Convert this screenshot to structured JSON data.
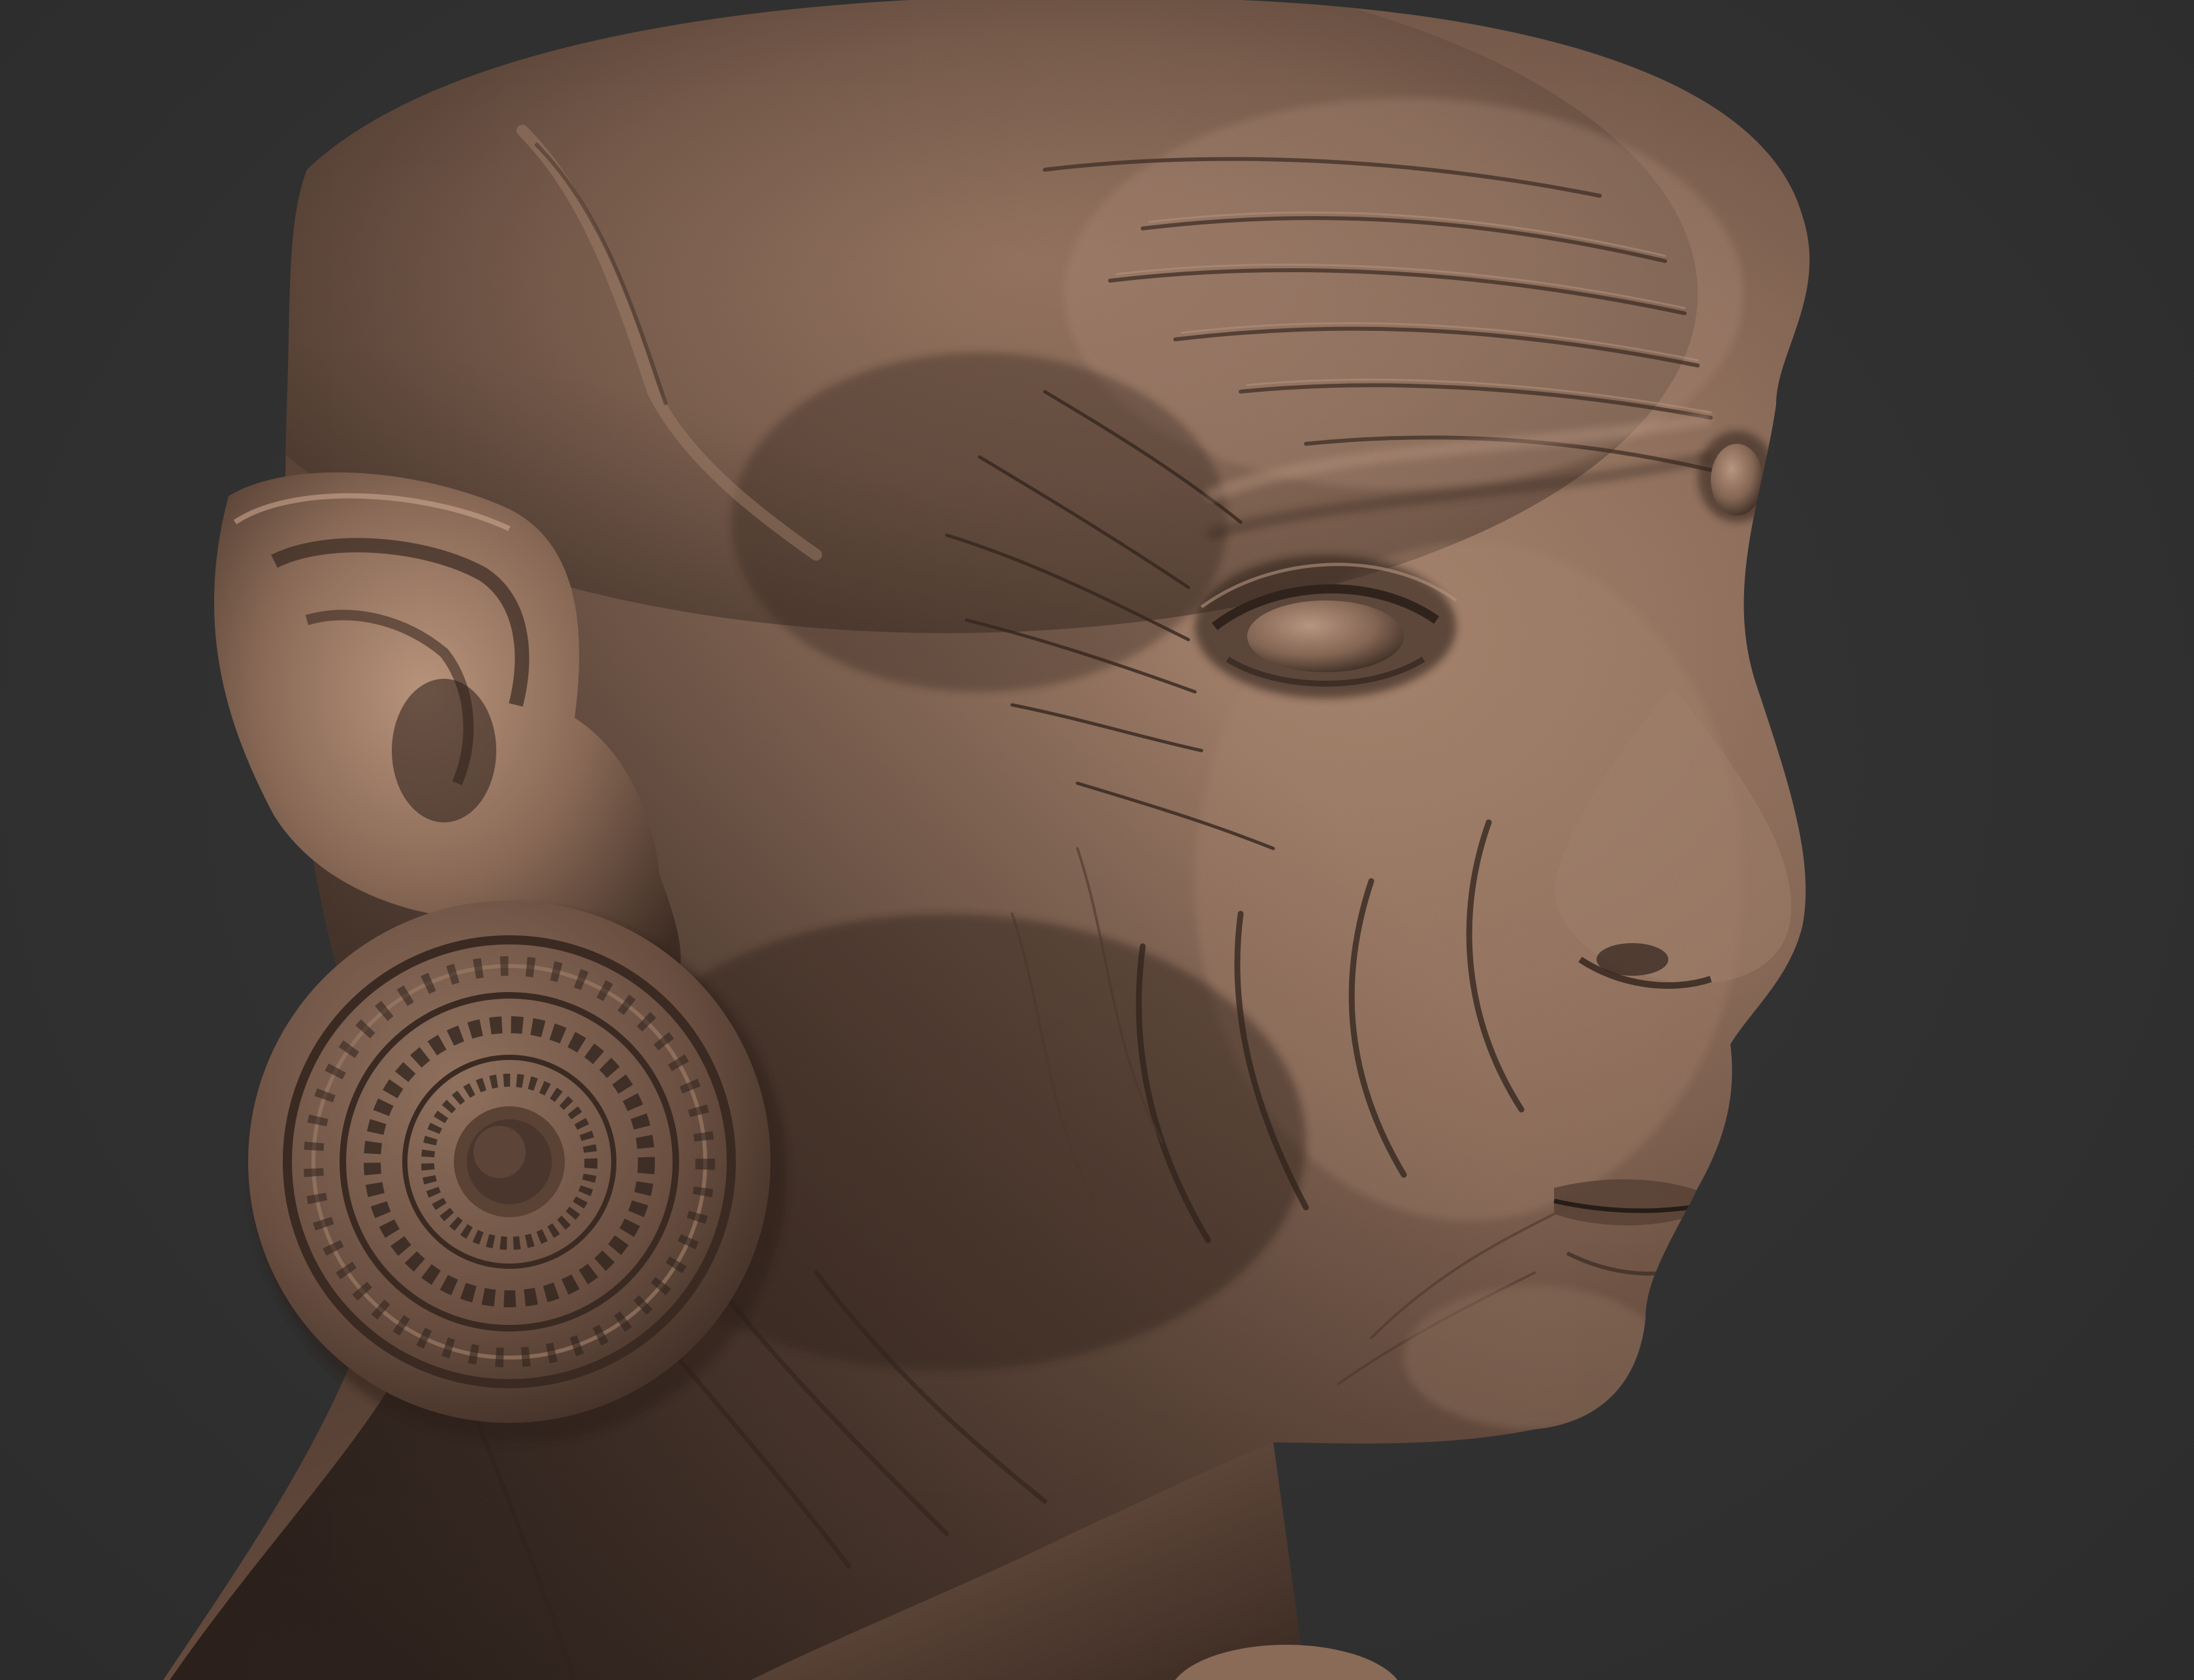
{
  "scene": {
    "subject": "sculpted-elderly-head",
    "material_color": "#8a6b58",
    "highlight_color": "#c9a58e",
    "shadow_color": "#2a1d17",
    "background_color": "#313131"
  }
}
